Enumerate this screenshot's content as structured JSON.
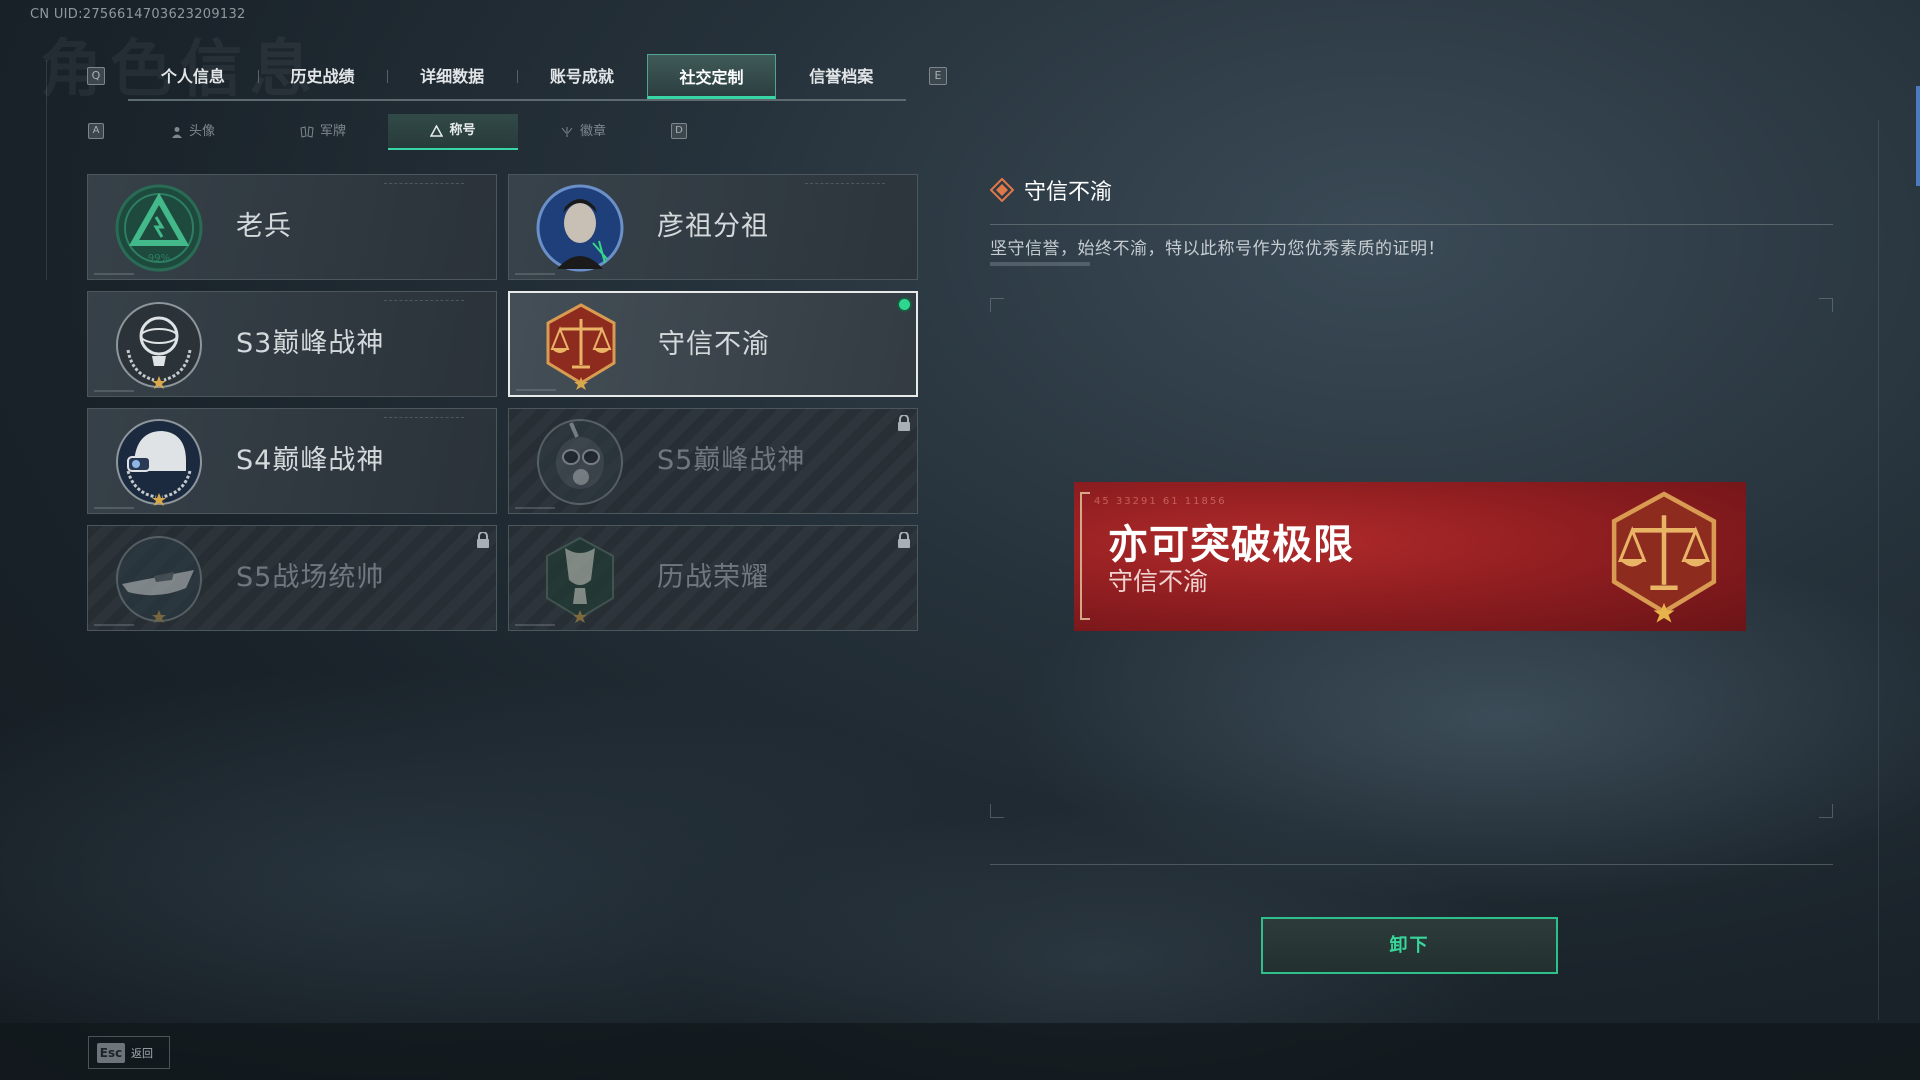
{
  "header": {
    "uid": "CN UID:2756614703623209132",
    "bg_title": "角色信息"
  },
  "keys": {
    "prev_tab": "Q",
    "next_tab": "E",
    "prev_sub": "A",
    "next_sub": "D"
  },
  "tabs": [
    {
      "label": "个人信息"
    },
    {
      "label": "历史战绩"
    },
    {
      "label": "详细数据"
    },
    {
      "label": "账号成就"
    },
    {
      "label": "社交定制",
      "active": true
    },
    {
      "label": "信誉档案"
    }
  ],
  "subtabs": [
    {
      "label": "头像",
      "icon": "person-icon"
    },
    {
      "label": "军牌",
      "icon": "dogtag-icon"
    },
    {
      "label": "称号",
      "icon": "title-triangle-icon",
      "active": true
    },
    {
      "label": "徽章",
      "icon": "emblem-icon"
    }
  ],
  "titles": [
    {
      "name": "老兵",
      "badge": "veteran-triangle-icon",
      "badge_text": "99%",
      "locked": false
    },
    {
      "name": "彦祖分祖",
      "badge": "portrait-icon",
      "locked": false
    },
    {
      "name": "S3巅峰战神",
      "badge": "globe-trophy-icon",
      "locked": false
    },
    {
      "name": "守信不渝",
      "badge": "scales-icon",
      "locked": false,
      "selected": true,
      "equipped": true
    },
    {
      "name": "S4巅峰战神",
      "badge": "helmet-icon",
      "locked": false
    },
    {
      "name": "S5巅峰战神",
      "badge": "gasmask-icon",
      "locked": true
    },
    {
      "name": "S5战场统帅",
      "badge": "boat-icon",
      "locked": true
    },
    {
      "name": "历战荣耀",
      "badge": "laurel-cup-icon",
      "locked": true
    }
  ],
  "detail": {
    "title": "守信不渝",
    "description": "坚守信誉，始终不渝，特以此称号作为您优秀素质的证明！",
    "preview_main": "亦可突破极限",
    "preview_sub": "守信不渝",
    "preview_code": "45 33291  61 11856",
    "action_label": "卸下"
  },
  "footer": {
    "esc_key": "Esc",
    "back_label": "返回"
  },
  "colors": {
    "accent": "#38d6a5",
    "banner_red": "#a02326",
    "equipped_dot": "#2fd68f"
  }
}
